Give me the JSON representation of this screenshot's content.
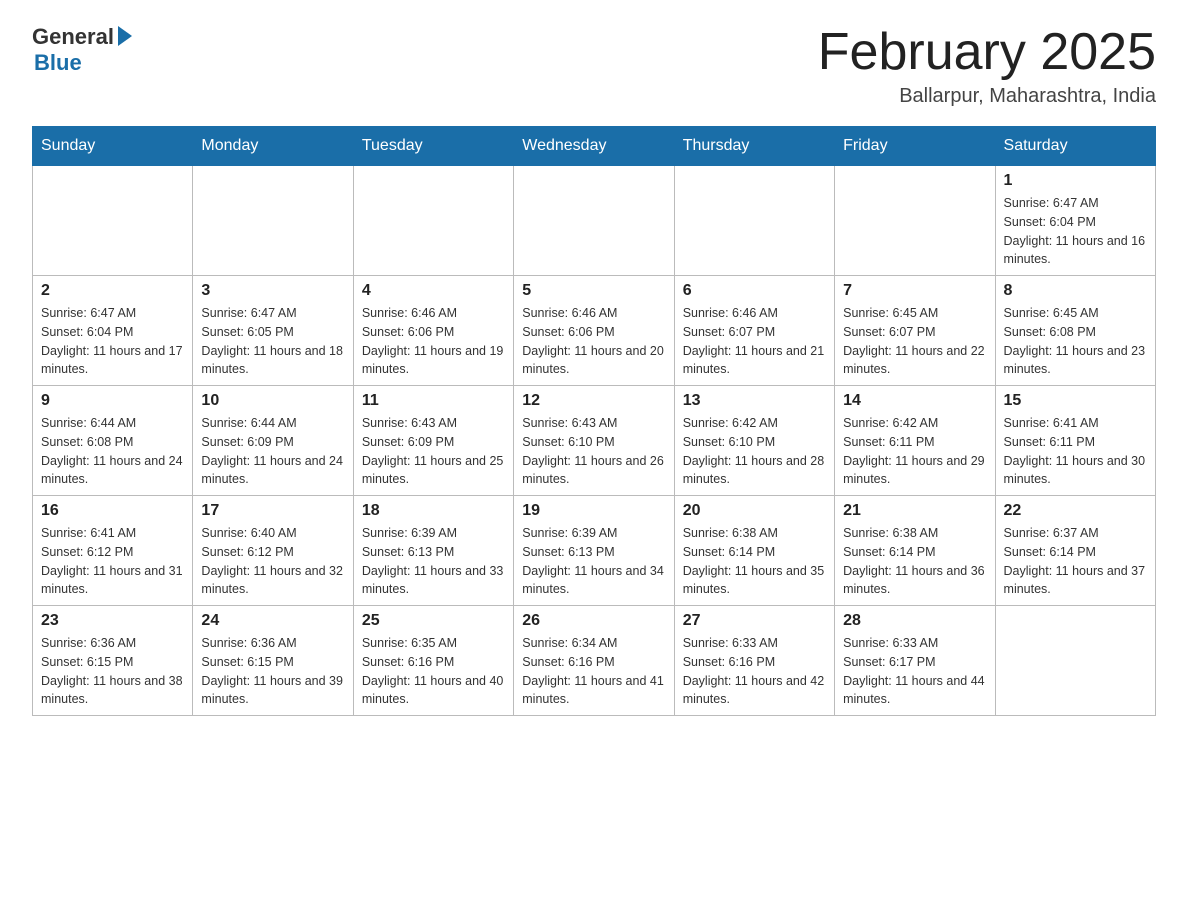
{
  "header": {
    "logo_general": "General",
    "logo_blue": "Blue",
    "month_title": "February 2025",
    "location": "Ballarpur, Maharashtra, India"
  },
  "days_of_week": [
    "Sunday",
    "Monday",
    "Tuesday",
    "Wednesday",
    "Thursday",
    "Friday",
    "Saturday"
  ],
  "weeks": [
    [
      {
        "day": "",
        "sunrise": "",
        "sunset": "",
        "daylight": ""
      },
      {
        "day": "",
        "sunrise": "",
        "sunset": "",
        "daylight": ""
      },
      {
        "day": "",
        "sunrise": "",
        "sunset": "",
        "daylight": ""
      },
      {
        "day": "",
        "sunrise": "",
        "sunset": "",
        "daylight": ""
      },
      {
        "day": "",
        "sunrise": "",
        "sunset": "",
        "daylight": ""
      },
      {
        "day": "",
        "sunrise": "",
        "sunset": "",
        "daylight": ""
      },
      {
        "day": "1",
        "sunrise": "Sunrise: 6:47 AM",
        "sunset": "Sunset: 6:04 PM",
        "daylight": "Daylight: 11 hours and 16 minutes."
      }
    ],
    [
      {
        "day": "2",
        "sunrise": "Sunrise: 6:47 AM",
        "sunset": "Sunset: 6:04 PM",
        "daylight": "Daylight: 11 hours and 17 minutes."
      },
      {
        "day": "3",
        "sunrise": "Sunrise: 6:47 AM",
        "sunset": "Sunset: 6:05 PM",
        "daylight": "Daylight: 11 hours and 18 minutes."
      },
      {
        "day": "4",
        "sunrise": "Sunrise: 6:46 AM",
        "sunset": "Sunset: 6:06 PM",
        "daylight": "Daylight: 11 hours and 19 minutes."
      },
      {
        "day": "5",
        "sunrise": "Sunrise: 6:46 AM",
        "sunset": "Sunset: 6:06 PM",
        "daylight": "Daylight: 11 hours and 20 minutes."
      },
      {
        "day": "6",
        "sunrise": "Sunrise: 6:46 AM",
        "sunset": "Sunset: 6:07 PM",
        "daylight": "Daylight: 11 hours and 21 minutes."
      },
      {
        "day": "7",
        "sunrise": "Sunrise: 6:45 AM",
        "sunset": "Sunset: 6:07 PM",
        "daylight": "Daylight: 11 hours and 22 minutes."
      },
      {
        "day": "8",
        "sunrise": "Sunrise: 6:45 AM",
        "sunset": "Sunset: 6:08 PM",
        "daylight": "Daylight: 11 hours and 23 minutes."
      }
    ],
    [
      {
        "day": "9",
        "sunrise": "Sunrise: 6:44 AM",
        "sunset": "Sunset: 6:08 PM",
        "daylight": "Daylight: 11 hours and 24 minutes."
      },
      {
        "day": "10",
        "sunrise": "Sunrise: 6:44 AM",
        "sunset": "Sunset: 6:09 PM",
        "daylight": "Daylight: 11 hours and 24 minutes."
      },
      {
        "day": "11",
        "sunrise": "Sunrise: 6:43 AM",
        "sunset": "Sunset: 6:09 PM",
        "daylight": "Daylight: 11 hours and 25 minutes."
      },
      {
        "day": "12",
        "sunrise": "Sunrise: 6:43 AM",
        "sunset": "Sunset: 6:10 PM",
        "daylight": "Daylight: 11 hours and 26 minutes."
      },
      {
        "day": "13",
        "sunrise": "Sunrise: 6:42 AM",
        "sunset": "Sunset: 6:10 PM",
        "daylight": "Daylight: 11 hours and 28 minutes."
      },
      {
        "day": "14",
        "sunrise": "Sunrise: 6:42 AM",
        "sunset": "Sunset: 6:11 PM",
        "daylight": "Daylight: 11 hours and 29 minutes."
      },
      {
        "day": "15",
        "sunrise": "Sunrise: 6:41 AM",
        "sunset": "Sunset: 6:11 PM",
        "daylight": "Daylight: 11 hours and 30 minutes."
      }
    ],
    [
      {
        "day": "16",
        "sunrise": "Sunrise: 6:41 AM",
        "sunset": "Sunset: 6:12 PM",
        "daylight": "Daylight: 11 hours and 31 minutes."
      },
      {
        "day": "17",
        "sunrise": "Sunrise: 6:40 AM",
        "sunset": "Sunset: 6:12 PM",
        "daylight": "Daylight: 11 hours and 32 minutes."
      },
      {
        "day": "18",
        "sunrise": "Sunrise: 6:39 AM",
        "sunset": "Sunset: 6:13 PM",
        "daylight": "Daylight: 11 hours and 33 minutes."
      },
      {
        "day": "19",
        "sunrise": "Sunrise: 6:39 AM",
        "sunset": "Sunset: 6:13 PM",
        "daylight": "Daylight: 11 hours and 34 minutes."
      },
      {
        "day": "20",
        "sunrise": "Sunrise: 6:38 AM",
        "sunset": "Sunset: 6:14 PM",
        "daylight": "Daylight: 11 hours and 35 minutes."
      },
      {
        "day": "21",
        "sunrise": "Sunrise: 6:38 AM",
        "sunset": "Sunset: 6:14 PM",
        "daylight": "Daylight: 11 hours and 36 minutes."
      },
      {
        "day": "22",
        "sunrise": "Sunrise: 6:37 AM",
        "sunset": "Sunset: 6:14 PM",
        "daylight": "Daylight: 11 hours and 37 minutes."
      }
    ],
    [
      {
        "day": "23",
        "sunrise": "Sunrise: 6:36 AM",
        "sunset": "Sunset: 6:15 PM",
        "daylight": "Daylight: 11 hours and 38 minutes."
      },
      {
        "day": "24",
        "sunrise": "Sunrise: 6:36 AM",
        "sunset": "Sunset: 6:15 PM",
        "daylight": "Daylight: 11 hours and 39 minutes."
      },
      {
        "day": "25",
        "sunrise": "Sunrise: 6:35 AM",
        "sunset": "Sunset: 6:16 PM",
        "daylight": "Daylight: 11 hours and 40 minutes."
      },
      {
        "day": "26",
        "sunrise": "Sunrise: 6:34 AM",
        "sunset": "Sunset: 6:16 PM",
        "daylight": "Daylight: 11 hours and 41 minutes."
      },
      {
        "day": "27",
        "sunrise": "Sunrise: 6:33 AM",
        "sunset": "Sunset: 6:16 PM",
        "daylight": "Daylight: 11 hours and 42 minutes."
      },
      {
        "day": "28",
        "sunrise": "Sunrise: 6:33 AM",
        "sunset": "Sunset: 6:17 PM",
        "daylight": "Daylight: 11 hours and 44 minutes."
      },
      {
        "day": "",
        "sunrise": "",
        "sunset": "",
        "daylight": ""
      }
    ]
  ]
}
